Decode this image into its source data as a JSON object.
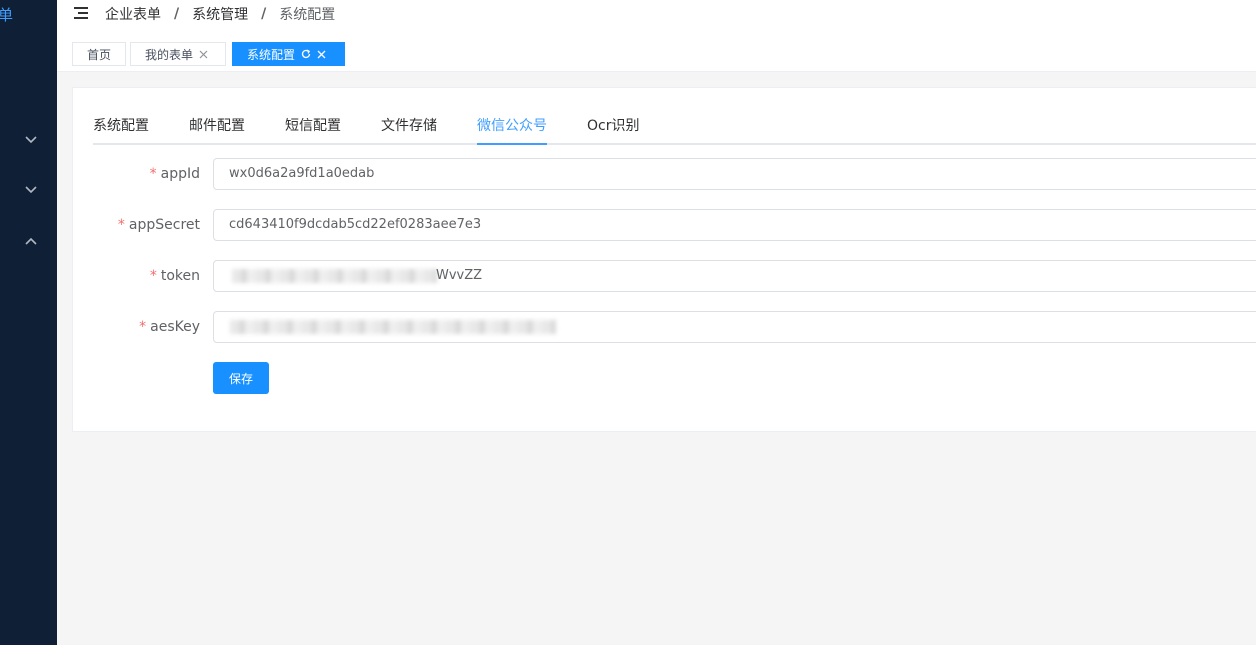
{
  "sidebar": {
    "logo_fragment": "单",
    "menu_chevrons": [
      "chevron-down",
      "chevron-down",
      "chevron-up"
    ]
  },
  "breadcrumb": {
    "items": [
      "企业表单",
      "系统管理",
      "系统配置"
    ],
    "separator": "/"
  },
  "tags": [
    {
      "label": "首页",
      "closable": false,
      "active": false
    },
    {
      "label": "我的表单",
      "closable": true,
      "active": false
    },
    {
      "label": "系统配置",
      "closable": true,
      "active": true,
      "refresh": true
    }
  ],
  "tabs": [
    "系统配置",
    "邮件配置",
    "短信配置",
    "文件存储",
    "微信公众号",
    "Ocr识别"
  ],
  "active_tab": "微信公众号",
  "form": {
    "fields": [
      {
        "label": "appId",
        "required": true,
        "value": "wx0d6a2a9fd1a0edab"
      },
      {
        "label": "appSecret",
        "required": true,
        "value": "cd643410f9dcdab5cd22ef0283aee7e3"
      },
      {
        "label": "token",
        "required": true,
        "value": "WvvZZ",
        "redacted": true
      },
      {
        "label": "aesKey",
        "required": true,
        "value": "",
        "redacted": true
      }
    ],
    "required_mark": "*",
    "save_label": "保存"
  },
  "colors": {
    "sidebar_bg": "#0f1f35",
    "accent": "#1890ff",
    "active_tab": "#409eff",
    "required": "#f56c6c"
  }
}
